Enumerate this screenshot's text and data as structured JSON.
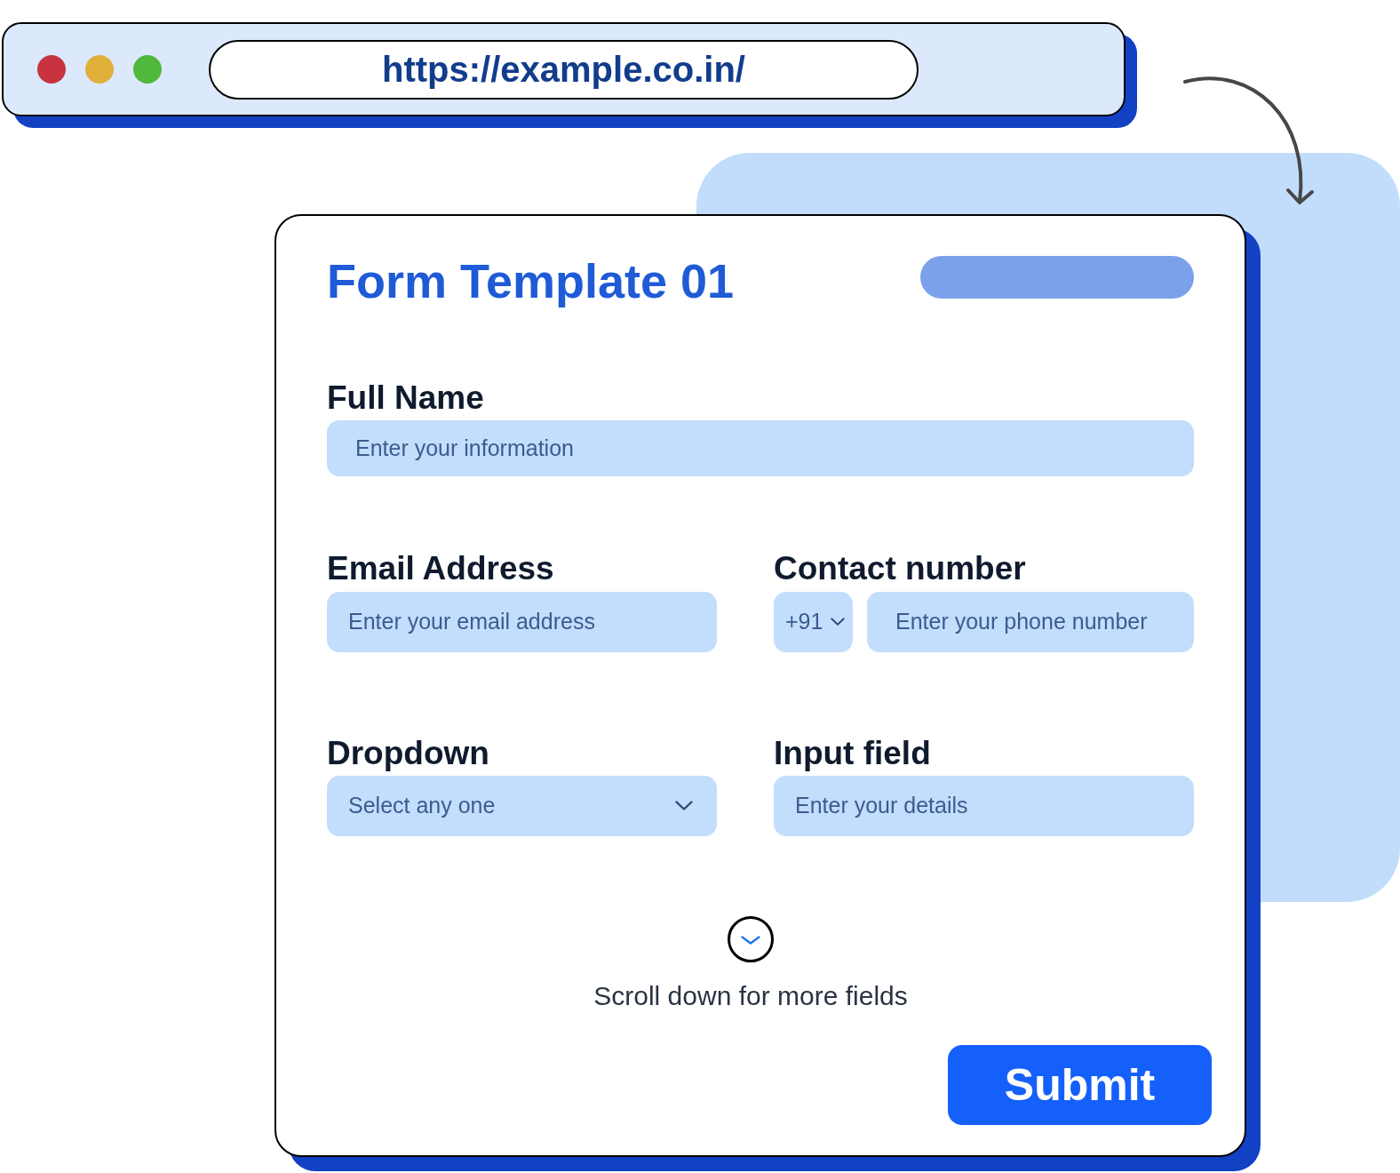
{
  "browser": {
    "window_buttons": [
      {
        "color": "#c7343f"
      },
      {
        "color": "#e0b03a"
      },
      {
        "color": "#50b83a"
      }
    ],
    "url": "https://example.co.in/"
  },
  "form": {
    "title": "Form Template 01",
    "rows": [
      [
        {
          "kind": "text",
          "label": "Full Name",
          "placeholder": "Enter your information"
        }
      ],
      [
        {
          "kind": "text",
          "label": "Email Address",
          "placeholder": "Enter your email address"
        },
        {
          "kind": "phone",
          "label": "Contact number",
          "country_code": "+91",
          "placeholder": "Enter your phone number"
        }
      ],
      [
        {
          "kind": "select",
          "label": "Dropdown",
          "placeholder": "Select any one"
        },
        {
          "kind": "text",
          "label": "Input field",
          "placeholder": "Enter your details"
        }
      ]
    ],
    "scroll_hint": "Scroll down for more fields",
    "submit": "Submit"
  }
}
